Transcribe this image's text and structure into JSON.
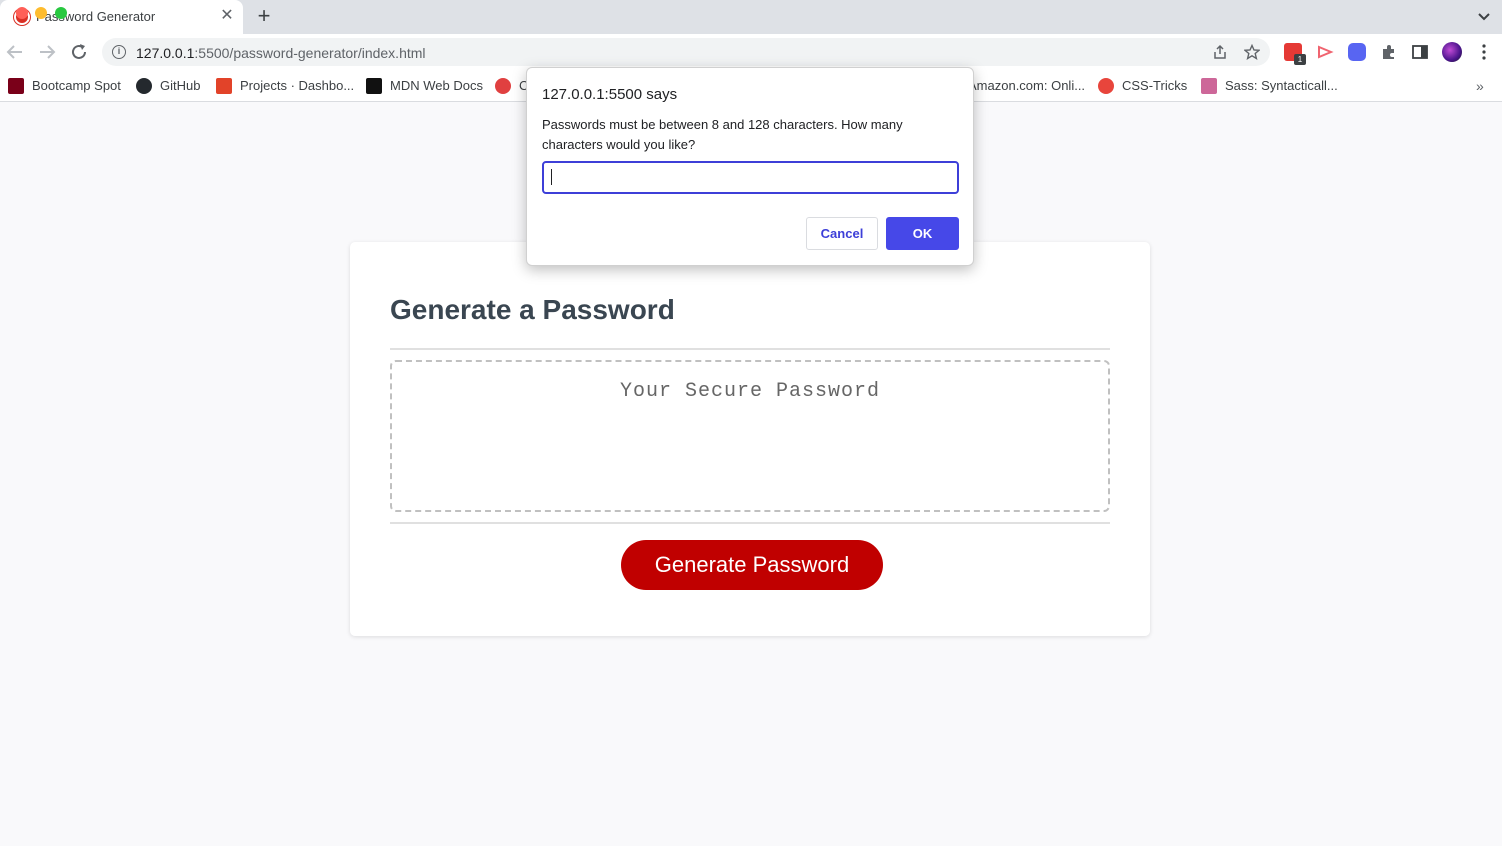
{
  "browser": {
    "tab_title": "Password Generator",
    "tab_close": "✕",
    "new_tab": "+",
    "url_host": "127.0.0.1",
    "url_path": ":5500/password-generator/index.html",
    "extension_badge": "1"
  },
  "bookmarks": [
    {
      "label": "Bootcamp Spot",
      "icon": "bootcamp-icon",
      "color": "#7a0019"
    },
    {
      "label": "GitHub",
      "icon": "github-icon",
      "color": "#24292e"
    },
    {
      "label": "Projects · Dashbo...",
      "icon": "gitlab-icon",
      "color": "#e24329"
    },
    {
      "label": "MDN Web Docs",
      "icon": "mdn-icon",
      "color": "#111111"
    },
    {
      "label": "C",
      "icon": "codepen-icon",
      "color": "#e04040"
    },
    {
      "label": "Amazon.com: Onli...",
      "icon": "amazon-icon",
      "color": "#ff9900"
    },
    {
      "label": "CSS-Tricks",
      "icon": "css-tricks-icon",
      "color": "#e8453c"
    },
    {
      "label": "Sass: Syntacticall...",
      "icon": "sass-icon",
      "color": "#cd6799"
    }
  ],
  "page": {
    "title": "Generate a Password",
    "password_placeholder": "Your Secure Password",
    "generate_button": "Generate Password"
  },
  "dialog": {
    "title": "127.0.0.1:5500 says",
    "message": "Passwords must be between 8 and 128 characters. How many characters would you like?",
    "input_value": "",
    "cancel_label": "Cancel",
    "ok_label": "OK"
  },
  "colors": {
    "accent_button": "#c00000",
    "dialog_ok": "#4648e8"
  }
}
